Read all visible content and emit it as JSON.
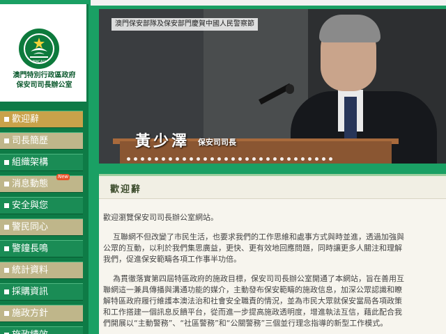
{
  "org": {
    "name_line1": "澳門特別行政區政府",
    "name_line2": "保安司司長辦公室",
    "emblem_text": "MACAU"
  },
  "nav": {
    "items": [
      {
        "label": "歡迎辭",
        "state": "active"
      },
      {
        "label": "司長簡歷",
        "state": "plain"
      },
      {
        "label": "組織架構",
        "state": "normal"
      },
      {
        "label": "消息動態",
        "state": "plain",
        "badge": "New"
      },
      {
        "label": "安全與您",
        "state": "normal"
      },
      {
        "label": "警民同心",
        "state": "plain"
      },
      {
        "label": "警鐘長鳴",
        "state": "normal"
      },
      {
        "label": "統計資料",
        "state": "plain"
      },
      {
        "label": "採購資訊",
        "state": "normal"
      },
      {
        "label": "施政方針",
        "state": "plain"
      },
      {
        "label": "施政績效",
        "state": "normal"
      }
    ]
  },
  "banner": {
    "caption": "澳門保安部隊及保安部門慶賀中國人民警察節",
    "speaker_name": "黃少澤",
    "speaker_title": "保安司司長",
    "slide_count": 30
  },
  "content": {
    "title": "歡迎辭",
    "paragraphs": [
      [
        "歡迎瀏覽保安司司長辦公室網站。"
      ],
      [
        "互聯網不但改變了市民生活，也要求我們的工作思維和處事方式與時並進，透過加強與",
        "公眾的互動，以利於我們集思廣益，更快、更有效地回應問題，同時讓更多人關注和理解",
        "我們，促進保安範疇各項工作事半功倍。"
      ],
      [
        "為貫徹落實第四屆特區政府的施政目標，保安司司長辦公室開通了本網站，旨在善用互",
        "聯網這一兼具傳播與溝通功能的媒介，主動發布保安範疇的施政信息，加深公眾認識和瞭",
        "解特區政府履行維護本澳法治和社會安全職責的情況，並為市民大眾就保安當局各項政策",
        "和工作搭建一個訊息反饋平台，從而進一步提高施政透明度，增進執法互信，藉此配合我",
        "們開展以“主動警務”、“社區警務”和“公關警務”三個並行理念指導的新型工作模式。"
      ]
    ]
  },
  "colors": {
    "page_green": "#1aa064",
    "nav_green": "#1a8c55",
    "nav_active": "#c9a24a",
    "nav_plain": "#bfb68a",
    "badge": "#e8532a"
  }
}
